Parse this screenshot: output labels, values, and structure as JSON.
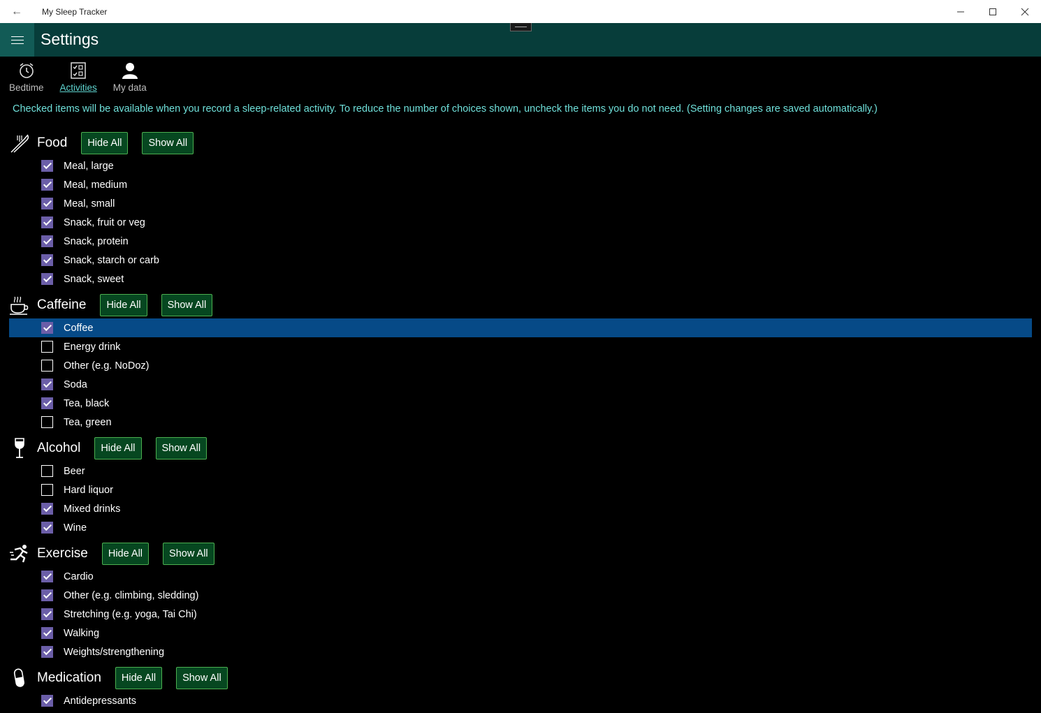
{
  "window": {
    "title": "My Sleep Tracker"
  },
  "header": {
    "title": "Settings"
  },
  "tabs": [
    {
      "label": "Bedtime",
      "icon": "alarm-clock-icon",
      "active": false
    },
    {
      "label": "Activities",
      "icon": "checklist-icon",
      "active": true
    },
    {
      "label": "My data",
      "icon": "person-icon",
      "active": false
    }
  ],
  "intro": "Checked items will be available when you record a sleep-related activity. To reduce the number of choices shown, uncheck the items you do not need. (Setting changes are saved automatically.)",
  "buttons": {
    "hide_all": "Hide All",
    "show_all": "Show All"
  },
  "colors": {
    "accent": "#073d3a",
    "checkbox": "#6b5ea8",
    "selection": "#064a87",
    "button_bg": "#064720",
    "intro_text": "#6fe0da"
  },
  "groups": [
    {
      "label": "Food",
      "icon": "fork-knife-icon",
      "items": [
        {
          "label": "Meal, large",
          "checked": true
        },
        {
          "label": "Meal, medium",
          "checked": true
        },
        {
          "label": "Meal, small",
          "checked": true
        },
        {
          "label": "Snack, fruit or veg",
          "checked": true
        },
        {
          "label": "Snack, protein",
          "checked": true
        },
        {
          "label": "Snack, starch or carb",
          "checked": true
        },
        {
          "label": "Snack, sweet",
          "checked": true
        }
      ]
    },
    {
      "label": "Caffeine",
      "icon": "coffee-cup-icon",
      "items": [
        {
          "label": "Coffee",
          "checked": true,
          "selected": true
        },
        {
          "label": "Energy drink",
          "checked": false
        },
        {
          "label": "Other (e.g. NoDoz)",
          "checked": false
        },
        {
          "label": "Soda",
          "checked": true
        },
        {
          "label": "Tea, black",
          "checked": true
        },
        {
          "label": "Tea, green",
          "checked": false
        }
      ]
    },
    {
      "label": "Alcohol",
      "icon": "wine-glass-icon",
      "items": [
        {
          "label": "Beer",
          "checked": false
        },
        {
          "label": "Hard liquor",
          "checked": false
        },
        {
          "label": "Mixed drinks",
          "checked": true
        },
        {
          "label": "Wine",
          "checked": true
        }
      ]
    },
    {
      "label": "Exercise",
      "icon": "running-person-icon",
      "items": [
        {
          "label": "Cardio",
          "checked": true
        },
        {
          "label": "Other (e.g. climbing, sledding)",
          "checked": true
        },
        {
          "label": "Stretching (e.g. yoga, Tai Chi)",
          "checked": true
        },
        {
          "label": "Walking",
          "checked": true
        },
        {
          "label": "Weights/strengthening",
          "checked": true
        }
      ]
    },
    {
      "label": "Medication",
      "icon": "pill-icon",
      "items": [
        {
          "label": "Antidepressants",
          "checked": true
        }
      ]
    }
  ]
}
